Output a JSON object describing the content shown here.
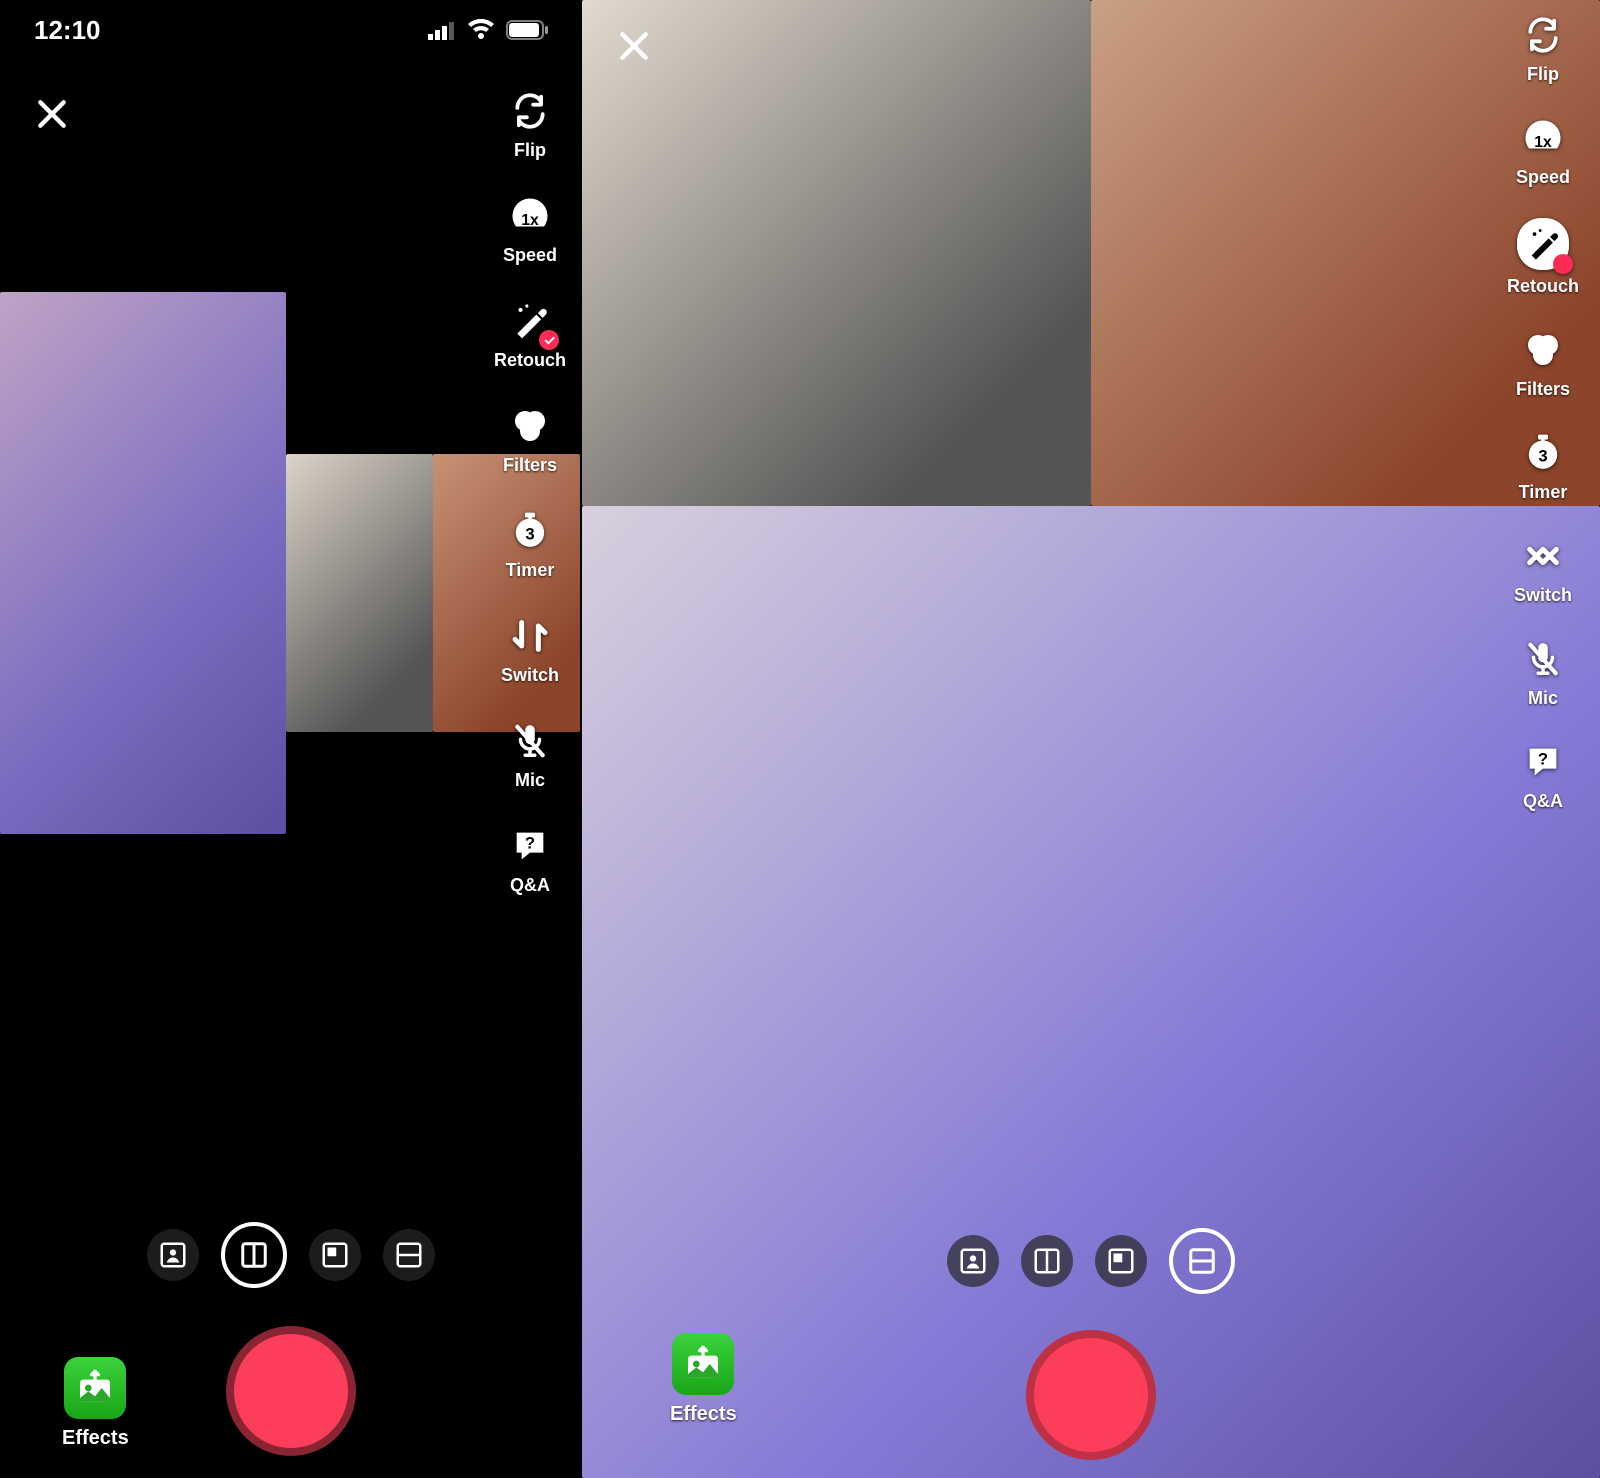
{
  "status_bar": {
    "time": "12:10"
  },
  "tools": {
    "flip": "Flip",
    "speed": "Speed",
    "retouch": "Retouch",
    "filters": "Filters",
    "timer": "Timer",
    "switch": "Switch",
    "mic": "Mic",
    "qa": "Q&A",
    "speed_value": "1x",
    "timer_value": "3"
  },
  "layouts": {
    "options": [
      "greenscreen",
      "side-by-side",
      "pip",
      "top-bottom"
    ],
    "left_selected": "side-by-side",
    "right_selected": "top-bottom"
  },
  "effects_label": "Effects",
  "colors": {
    "record": "#fd3e5b",
    "record_ring": "#8a2432",
    "accent": "#fe2c55",
    "effects_green_top": "#3cd23c",
    "effects_green_bottom": "#18a618"
  }
}
